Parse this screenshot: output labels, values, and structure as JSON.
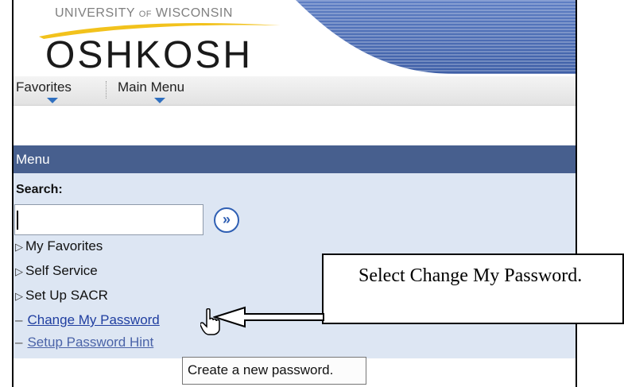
{
  "logo": {
    "top_line_a": "UNIVERSITY",
    "top_line_of": "OF",
    "top_line_b": "WISCONSIN",
    "main": "OSHKOSH"
  },
  "nav": {
    "favorites": "Favorites",
    "main_menu": "Main Menu"
  },
  "menu": {
    "title": "Menu",
    "search_label": "Search:",
    "search_value": "",
    "go_icon": "double-chevron-right-icon",
    "folders": [
      "My Favorites",
      "Self Service",
      "Set Up SACR"
    ],
    "links": [
      "Change My Password",
      "Setup Password Hint"
    ]
  },
  "callout": {
    "text": "Select Change My Password."
  },
  "tooltip": {
    "text": "Create a new password."
  },
  "colors": {
    "menu_header": "#475f8e",
    "menu_bg": "#dde6f3",
    "link": "#1f3ea0",
    "banner_stripes": "#5a7bc0"
  }
}
